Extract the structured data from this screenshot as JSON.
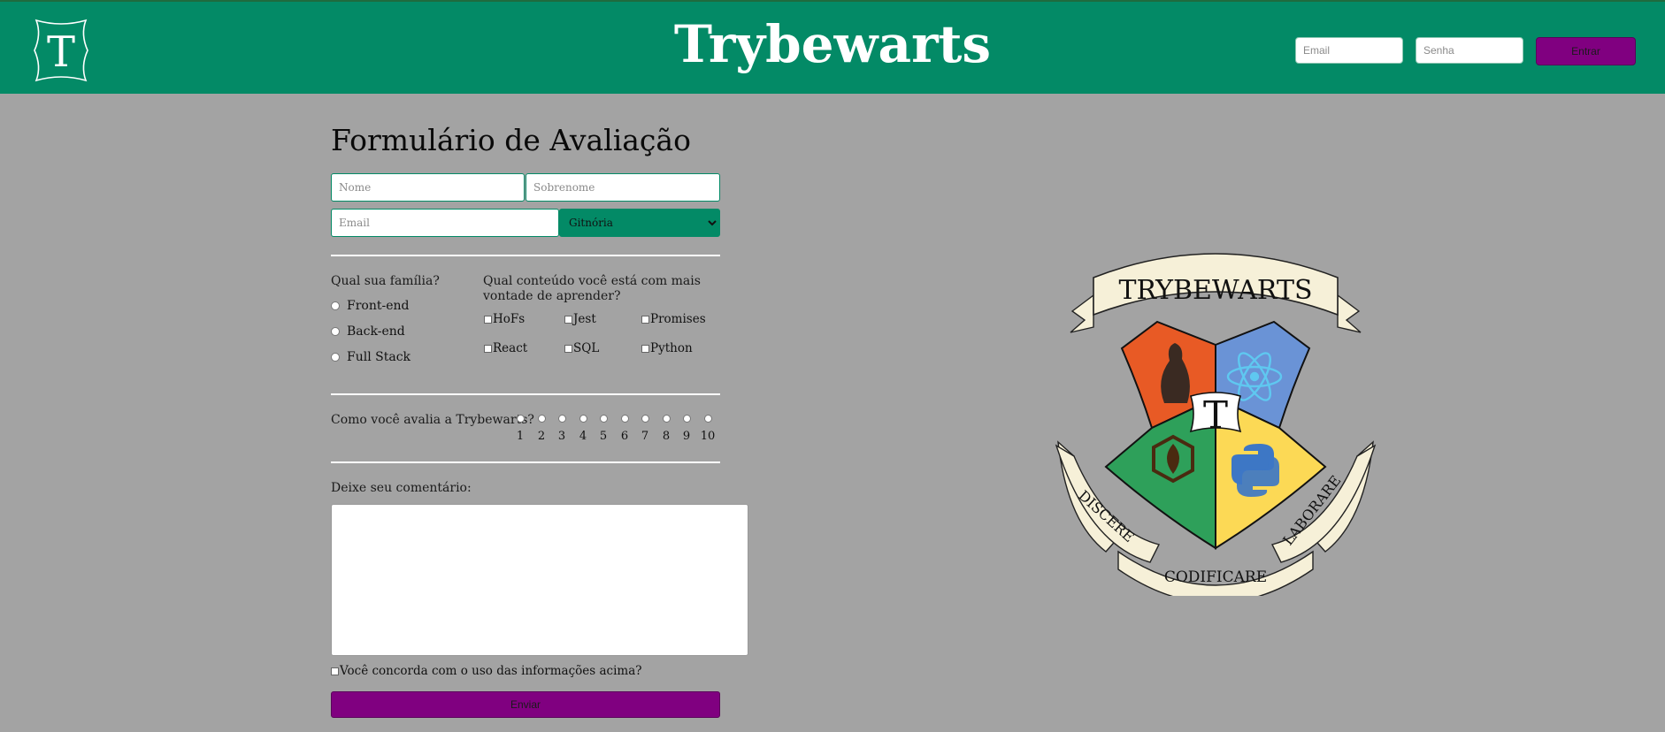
{
  "header": {
    "logo_letter": "T",
    "title": "Trybewarts",
    "email_placeholder": "Email",
    "password_placeholder": "Senha",
    "login_button": "Entrar"
  },
  "form": {
    "title": "Formulário de Avaliação",
    "first_name_placeholder": "Nome",
    "last_name_placeholder": "Sobrenome",
    "email_placeholder": "Email",
    "house_selected": "Gitnória",
    "family_question": "Qual sua família?",
    "families": [
      "Front-end",
      "Back-end",
      "Full Stack"
    ],
    "content_question": "Qual conteúdo você está com mais vontade de aprender?",
    "contents": [
      "HoFs",
      "Jest",
      "Promises",
      "React",
      "SQL",
      "Python"
    ],
    "rating_question": "Como você avalia a Trybewarts?",
    "ratings": [
      "1",
      "2",
      "3",
      "4",
      "5",
      "6",
      "7",
      "8",
      "9",
      "10"
    ],
    "comment_label": "Deixe seu comentário:",
    "agreement_label": "Você concorda com o uso das informações acima?",
    "submit_label": "Enviar"
  },
  "crest": {
    "banner_top": "TRYBEWARTS",
    "letter": "T",
    "motto_left": "DISCERE",
    "motto_center": "CODIFICARE",
    "motto_right": "LABORARE",
    "colors": {
      "orange": "#e85a25",
      "blue": "#6a93d6",
      "green": "#2ea05a",
      "yellow": "#fcd955",
      "parchment": "#f6f0d8"
    }
  },
  "colors": {
    "header_green": "#038a66",
    "purple": "#800080",
    "background": "#a3a3a3"
  }
}
